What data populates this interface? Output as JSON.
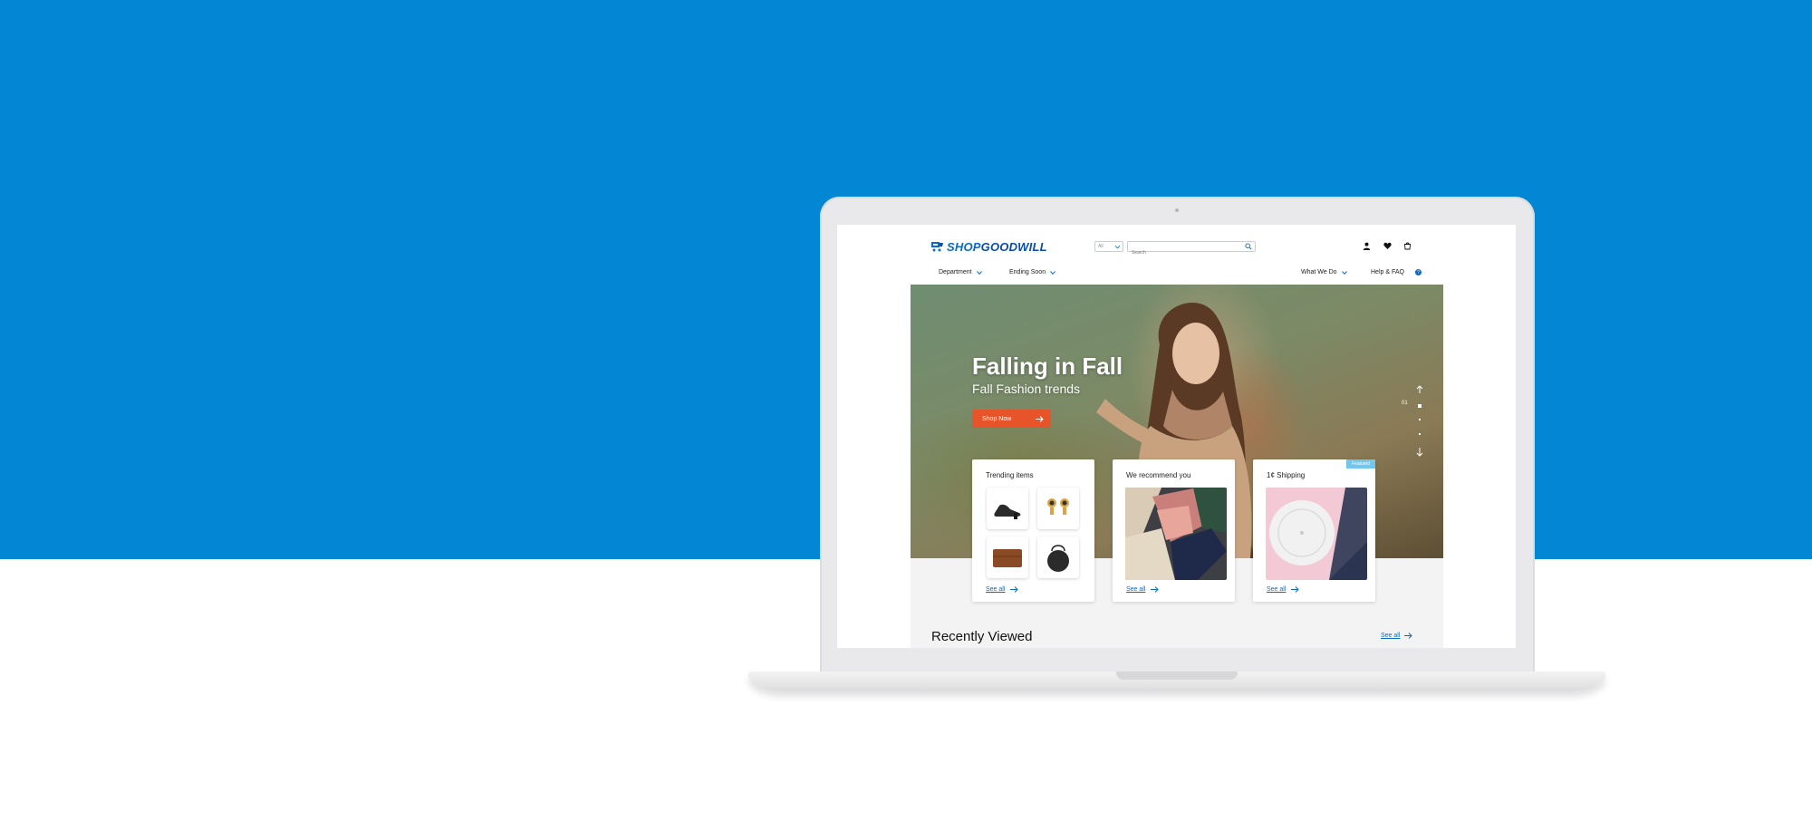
{
  "colors": {
    "background_blue": "#0386d3",
    "brand_blue": "#0a6bc4",
    "cta_orange": "#e8542a",
    "featured_badge": "#73c7ef"
  },
  "header": {
    "logo": {
      "shop": "SHOP",
      "goodwill": "GOODWILL",
      "icon": "shopping-cart-logo-icon"
    },
    "category_select": {
      "value": "All"
    },
    "search": {
      "placeholder": "Search",
      "icon": "search-icon"
    },
    "icons": [
      "account-icon",
      "heart-icon",
      "cart-icon"
    ]
  },
  "nav": {
    "left": [
      {
        "label": "Department"
      },
      {
        "label": "Ending Soon"
      }
    ],
    "right": [
      {
        "label": "What We Do"
      },
      {
        "label": "Help & FAQ",
        "badge": "?"
      }
    ]
  },
  "hero": {
    "title": "Falling in Fall",
    "subtitle": "Fall Fashion trends",
    "cta_label": "Shop Now",
    "slide_number": "01"
  },
  "cards": [
    {
      "title": "Trending items",
      "see_all": "See all",
      "items": [
        "sandal",
        "earrings",
        "wallet",
        "round-bag"
      ]
    },
    {
      "title": "We recommend you",
      "see_all": "See all"
    },
    {
      "title": "1¢ Shipping",
      "see_all": "See all",
      "badge": "Featured"
    }
  ],
  "recently_viewed": {
    "title": "Recently Viewed",
    "see_all": "See all"
  }
}
